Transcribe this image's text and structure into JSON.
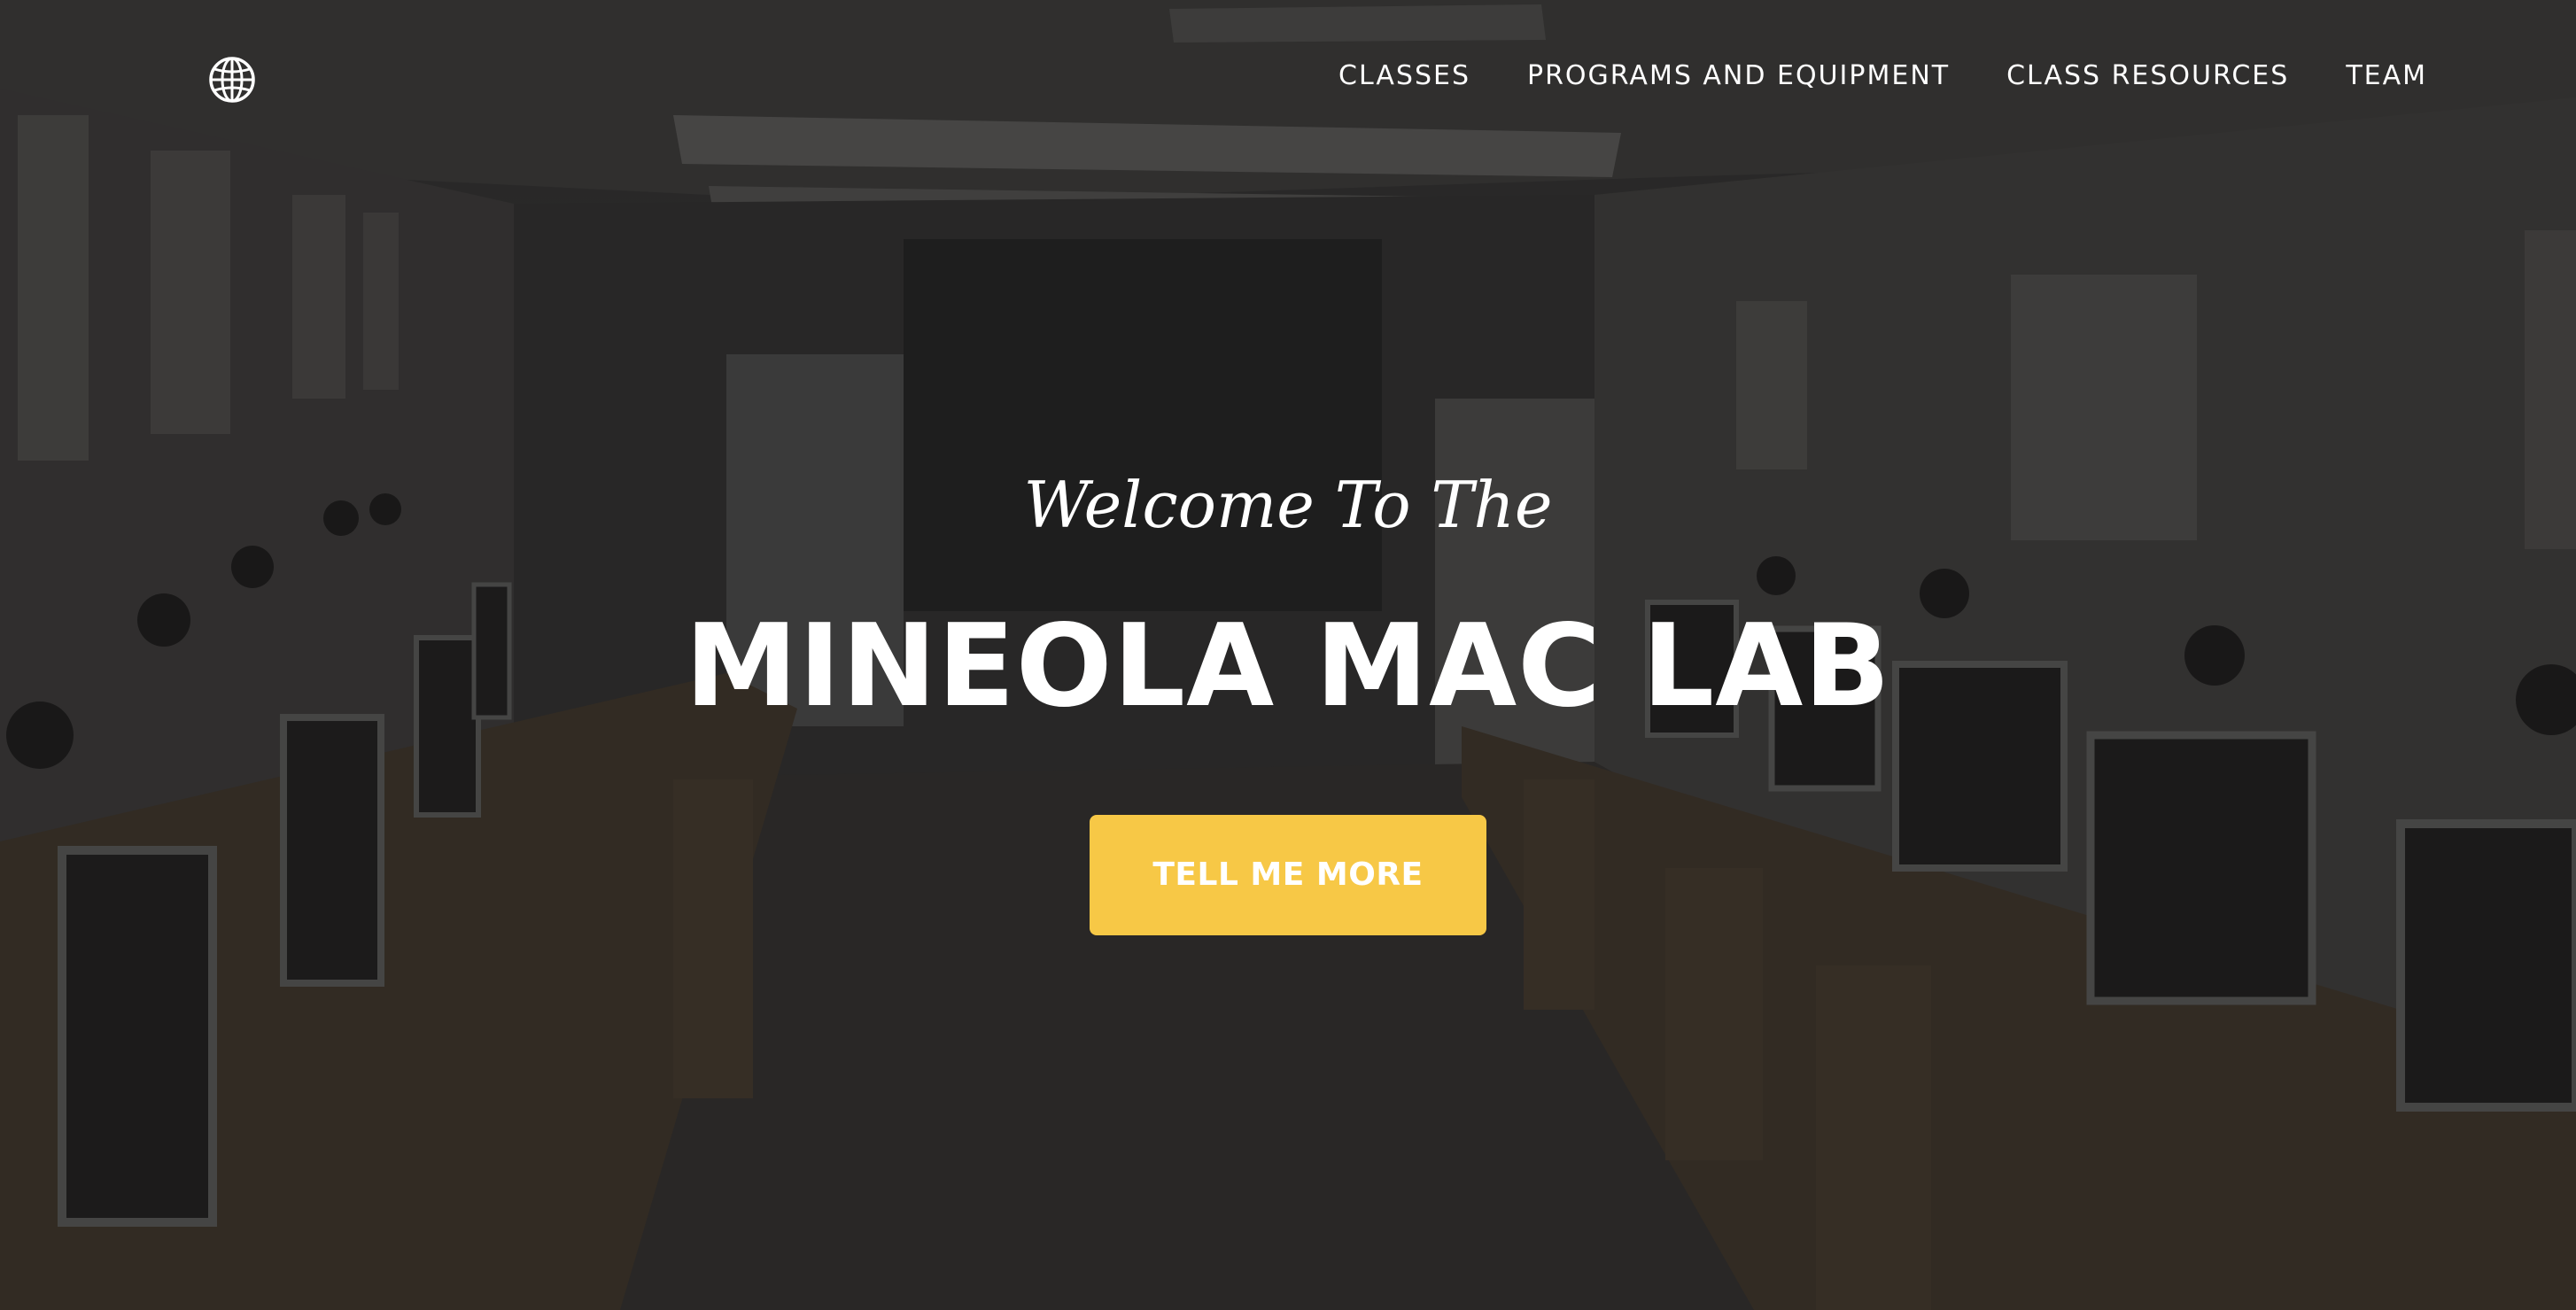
{
  "nav": {
    "brand_icon": "globe-icon",
    "links": [
      {
        "label": "CLASSES"
      },
      {
        "label": "PROGRAMS AND EQUIPMENT"
      },
      {
        "label": "CLASS RESOURCES"
      },
      {
        "label": "TEAM"
      }
    ]
  },
  "hero": {
    "lead_in": "Welcome To The",
    "heading": "MINEOLA MAC LAB",
    "cta_label": "TELL ME MORE",
    "background": "computer-lab-photo"
  },
  "colors": {
    "accent": "#f7c846",
    "text": "#ffffff"
  }
}
